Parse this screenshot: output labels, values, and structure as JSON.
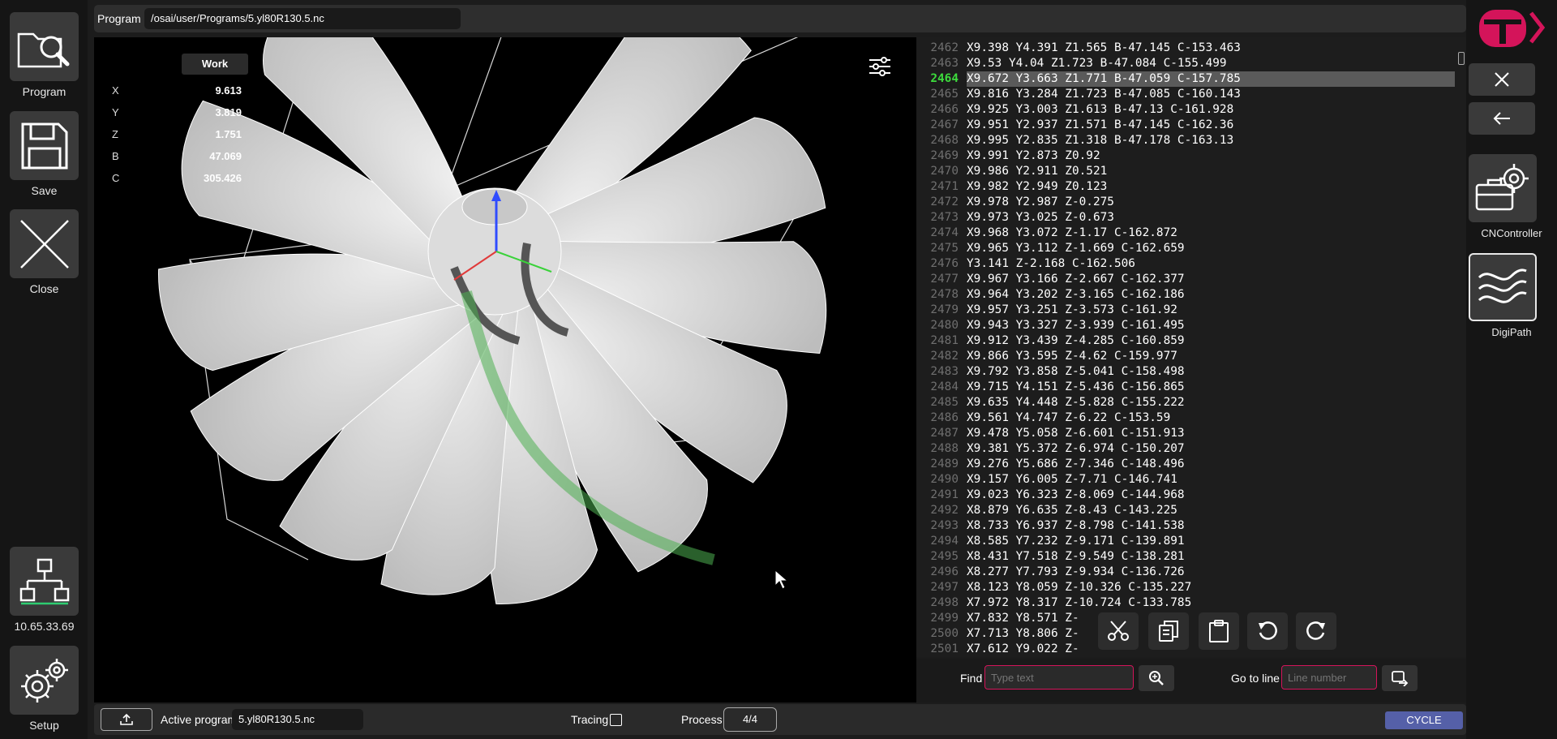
{
  "colors": {
    "accent": "#d4145a",
    "current_line": "#3ddc3d",
    "cycle": "#5560a8",
    "toolpath_green": "#4caf50"
  },
  "left_sidebar": {
    "program": {
      "label": "Program",
      "icon": "folder-search-icon"
    },
    "save": {
      "label": "Save",
      "icon": "floppy-disk-icon"
    },
    "close": {
      "label": "Close",
      "icon": "close-x-icon"
    },
    "network": {
      "label": "10.65.33.69",
      "icon": "network-tree-icon"
    },
    "setup": {
      "label": "Setup",
      "icon": "gears-icon"
    }
  },
  "right_sidebar": {
    "logo": "brand-logo-icon",
    "close_icon": "close-icon",
    "back_icon": "arrow-left-icon",
    "cncontroller": {
      "label": "CNController",
      "icon": "gears-toolbox-icon"
    },
    "digipath": {
      "label": "DigiPath",
      "icon": "wave-paths-icon"
    }
  },
  "program_bar": {
    "label": "Program",
    "path": "/osai/user/Programs/5.yl80R130.5.nc"
  },
  "work": {
    "header": "Work",
    "axes": [
      {
        "name": "X",
        "value": "9.613"
      },
      {
        "name": "Y",
        "value": "3.819"
      },
      {
        "name": "Z",
        "value": "1.751"
      },
      {
        "name": "B",
        "value": "47.069"
      },
      {
        "name": "C",
        "value": "305.426"
      }
    ]
  },
  "code": {
    "current_line": "2464",
    "lines": [
      {
        "n": "2462",
        "t": "X9.398 Y4.391 Z1.565 B-47.145 C-153.463"
      },
      {
        "n": "2463",
        "t": "X9.53 Y4.04 Z1.723 B-47.084 C-155.499"
      },
      {
        "n": "2464",
        "t": "X9.672 Y3.663 Z1.771 B-47.059 C-157.785"
      },
      {
        "n": "2465",
        "t": "X9.816 Y3.284 Z1.723 B-47.085 C-160.143"
      },
      {
        "n": "2466",
        "t": "X9.925 Y3.003 Z1.613 B-47.13 C-161.928"
      },
      {
        "n": "2467",
        "t": "X9.951 Y2.937 Z1.571 B-47.145 C-162.36"
      },
      {
        "n": "2468",
        "t": "X9.995 Y2.835 Z1.318 B-47.178 C-163.13"
      },
      {
        "n": "2469",
        "t": "X9.991 Y2.873 Z0.92"
      },
      {
        "n": "2470",
        "t": "X9.986 Y2.911 Z0.521"
      },
      {
        "n": "2471",
        "t": "X9.982 Y2.949 Z0.123"
      },
      {
        "n": "2472",
        "t": "X9.978 Y2.987 Z-0.275"
      },
      {
        "n": "2473",
        "t": "X9.973 Y3.025 Z-0.673"
      },
      {
        "n": "2474",
        "t": "X9.968 Y3.072 Z-1.17 C-162.872"
      },
      {
        "n": "2475",
        "t": "X9.965 Y3.112 Z-1.669 C-162.659"
      },
      {
        "n": "2476",
        "t": "Y3.141 Z-2.168 C-162.506"
      },
      {
        "n": "2477",
        "t": "X9.967 Y3.166 Z-2.667 C-162.377"
      },
      {
        "n": "2478",
        "t": "X9.964 Y3.202 Z-3.165 C-162.186"
      },
      {
        "n": "2479",
        "t": "X9.957 Y3.251 Z-3.573 C-161.92"
      },
      {
        "n": "2480",
        "t": "X9.943 Y3.327 Z-3.939 C-161.495"
      },
      {
        "n": "2481",
        "t": "X9.912 Y3.439 Z-4.285 C-160.859"
      },
      {
        "n": "2482",
        "t": "X9.866 Y3.595 Z-4.62 C-159.977"
      },
      {
        "n": "2483",
        "t": "X9.792 Y3.858 Z-5.041 C-158.498"
      },
      {
        "n": "2484",
        "t": "X9.715 Y4.151 Z-5.436 C-156.865"
      },
      {
        "n": "2485",
        "t": "X9.635 Y4.448 Z-5.828 C-155.222"
      },
      {
        "n": "2486",
        "t": "X9.561 Y4.747 Z-6.22 C-153.59"
      },
      {
        "n": "2487",
        "t": "X9.478 Y5.058 Z-6.601 C-151.913"
      },
      {
        "n": "2488",
        "t": "X9.381 Y5.372 Z-6.974 C-150.207"
      },
      {
        "n": "2489",
        "t": "X9.276 Y5.686 Z-7.346 C-148.496"
      },
      {
        "n": "2490",
        "t": "X9.157 Y6.005 Z-7.71 C-146.741"
      },
      {
        "n": "2491",
        "t": "X9.023 Y6.323 Z-8.069 C-144.968"
      },
      {
        "n": "2492",
        "t": "X8.879 Y6.635 Z-8.43 C-143.225"
      },
      {
        "n": "2493",
        "t": "X8.733 Y6.937 Z-8.798 C-141.538"
      },
      {
        "n": "2494",
        "t": "X8.585 Y7.232 Z-9.171 C-139.891"
      },
      {
        "n": "2495",
        "t": "X8.431 Y7.518 Z-9.549 C-138.281"
      },
      {
        "n": "2496",
        "t": "X8.277 Y7.793 Z-9.934 C-136.726"
      },
      {
        "n": "2497",
        "t": "X8.123 Y8.059 Z-10.326 C-135.227"
      },
      {
        "n": "2498",
        "t": "X7.972 Y8.317 Z-10.724 C-133.785"
      },
      {
        "n": "2499",
        "t": "X7.832 Y8.571 Z-"
      },
      {
        "n": "2500",
        "t": "X7.713 Y8.806 Z-"
      },
      {
        "n": "2501",
        "t": "X7.612 Y9.022 Z-"
      }
    ]
  },
  "edit_toolbar": {
    "cut": "scissors-icon",
    "copy": "copy-icon",
    "paste": "clipboard-icon",
    "undo": "undo-icon",
    "redo": "redo-icon"
  },
  "find": {
    "label": "Find",
    "placeholder": "Type text",
    "search_icon": "search-icon"
  },
  "goto": {
    "label": "Go to line",
    "placeholder": "Line number",
    "icon": "goto-line-icon"
  },
  "bottom": {
    "upload_icon": "upload-icon",
    "active_program_label": "Active program",
    "active_program_value": "5.yl80R130.5.nc",
    "tracing_label": "Tracing",
    "process_label": "Process",
    "process_value": "4/4",
    "cycle_label": "CYCLE"
  }
}
